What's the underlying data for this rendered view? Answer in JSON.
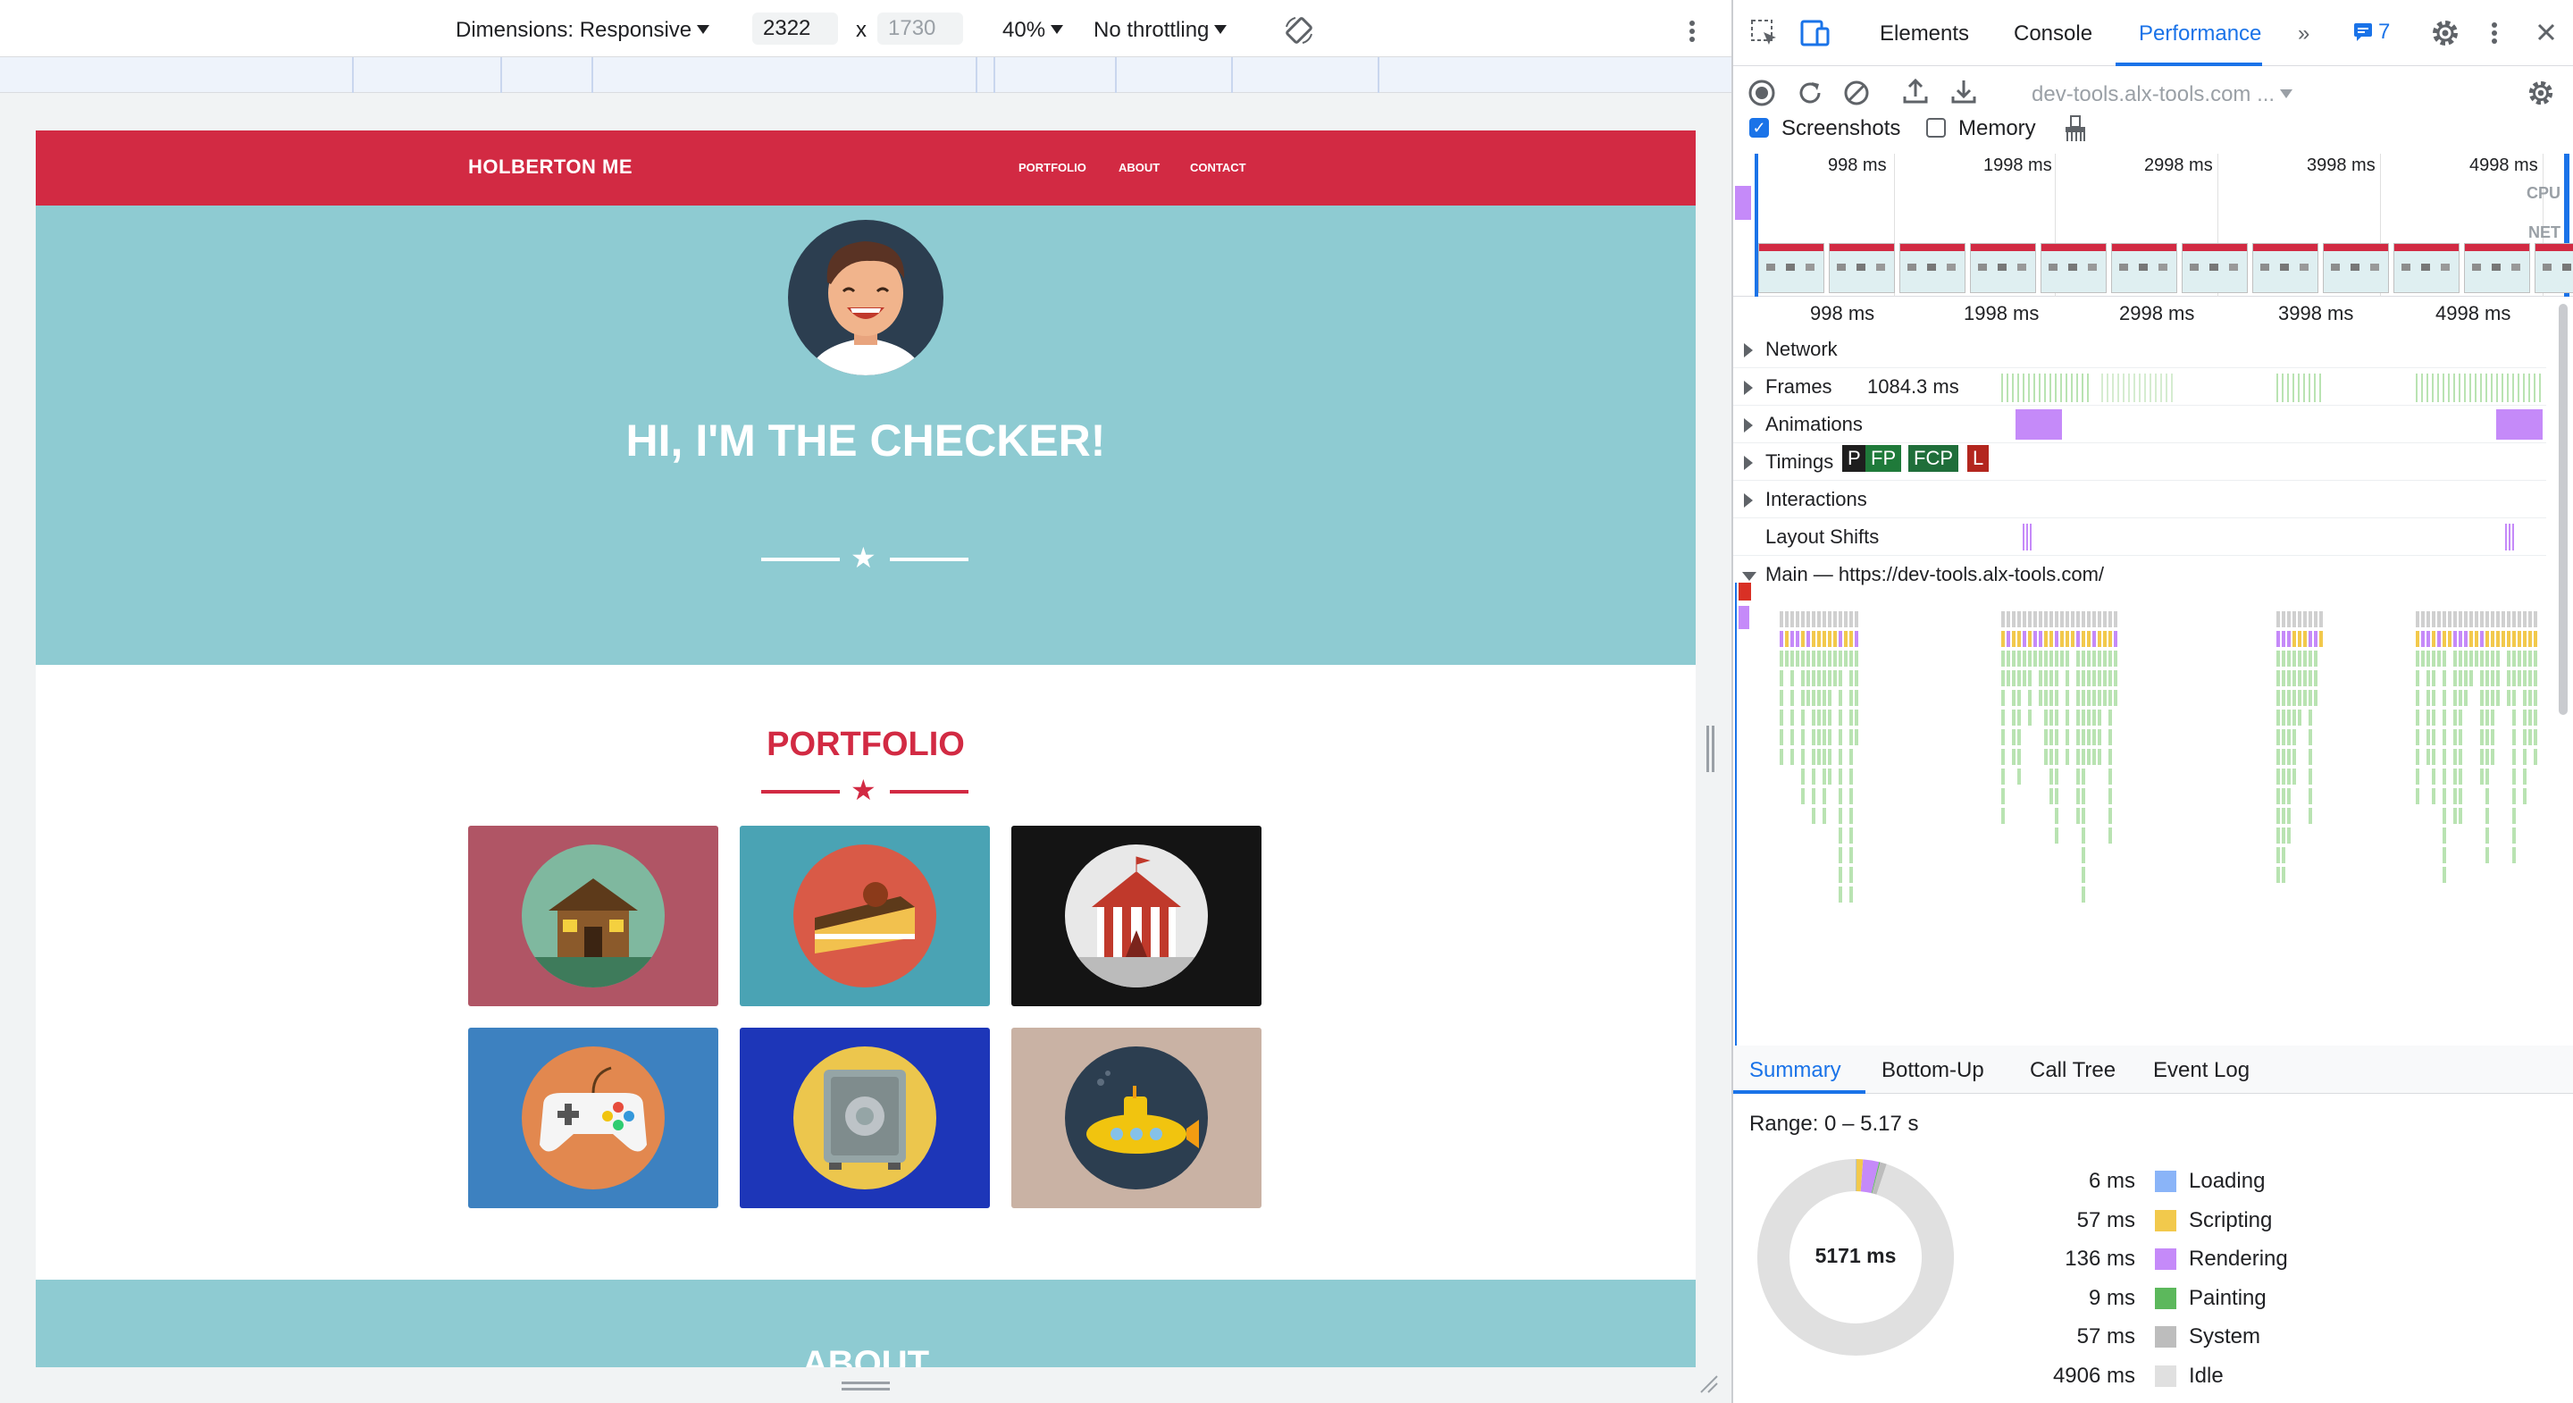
{
  "device_toolbar": {
    "dimensions_label": "Dimensions: Responsive",
    "width_value": "2322",
    "times": "x",
    "height_value": "1730",
    "zoom": "40%",
    "throttling": "No throttling"
  },
  "site": {
    "brand": "HOLBERTON ME",
    "nav": [
      "PORTFOLIO",
      "ABOUT",
      "CONTACT"
    ],
    "hero_title": "HI, I'M THE CHECKER!",
    "portfolio_title": "PORTFOLIO",
    "about_title": "ABOUT",
    "portfolio_items": [
      {
        "name": "cabin",
        "bg": "#b05565",
        "circle": "#7fb89f"
      },
      {
        "name": "cake",
        "bg": "#4aa3b4",
        "circle": "#d95a47"
      },
      {
        "name": "circus",
        "bg": "#141414",
        "circle": "#e8e8e8"
      },
      {
        "name": "game-controller",
        "bg": "#3d81c0",
        "circle": "#e2884f"
      },
      {
        "name": "safe",
        "bg": "#1d36b8",
        "circle": "#ecc64d"
      },
      {
        "name": "submarine",
        "bg": "#c9b2a4",
        "circle": "#2c3e50"
      }
    ],
    "colors": {
      "nav": "#d22a43",
      "hero": "#8ecbd2",
      "accent": "#d22a43"
    }
  },
  "devtools": {
    "tabs": [
      "Elements",
      "Console",
      "Performance"
    ],
    "active_tab": "Performance",
    "issues_count": "7",
    "url_select": "dev-tools.alx-tools.com ...",
    "screenshots_label": "Screenshots",
    "screenshots_checked": true,
    "memory_label": "Memory",
    "memory_checked": false,
    "overview_ticks": [
      "998 ms",
      "1998 ms",
      "2998 ms",
      "3998 ms",
      "4998 ms"
    ],
    "cpu_label": "CPU",
    "net_label": "NET",
    "timeline_ticks": [
      "998 ms",
      "1998 ms",
      "2998 ms",
      "3998 ms",
      "4998 ms"
    ],
    "tracks": {
      "network": "Network",
      "frames": "Frames",
      "frames_value": "1084.3 ms",
      "animations": "Animations",
      "timings": "Timings",
      "interactions": "Interactions",
      "layout_shifts": "Layout Shifts",
      "main": "Main — https://dev-tools.alx-tools.com/"
    },
    "timing_markers": [
      "P",
      "FP",
      "FCP",
      "L"
    ],
    "summary_tabs": [
      "Summary",
      "Bottom-Up",
      "Call Tree",
      "Event Log"
    ],
    "active_summary_tab": "Summary",
    "range": "Range: 0 – 5.17 s",
    "total": "5171 ms",
    "breakdown": [
      {
        "value": "6 ms",
        "name": "Loading",
        "ms": 6,
        "color": "#8ab4f8"
      },
      {
        "value": "57 ms",
        "name": "Scripting",
        "ms": 57,
        "color": "#f2c94c"
      },
      {
        "value": "136 ms",
        "name": "Rendering",
        "ms": 136,
        "color": "#c58af9"
      },
      {
        "value": "9 ms",
        "name": "Painting",
        "ms": 9,
        "color": "#5cb85c"
      },
      {
        "value": "57 ms",
        "name": "System",
        "ms": 57,
        "color": "#bdbdbd"
      },
      {
        "value": "4906 ms",
        "name": "Idle",
        "ms": 4906,
        "color": "#e0e0e0"
      }
    ]
  }
}
